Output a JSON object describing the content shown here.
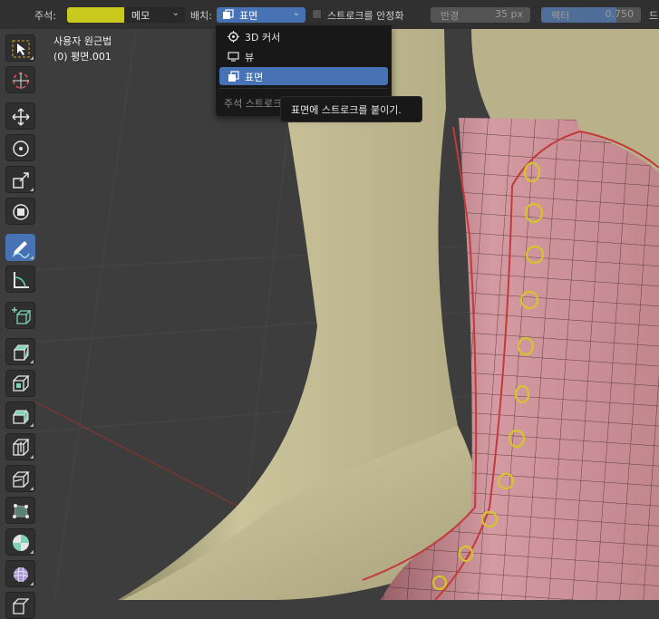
{
  "header": {
    "annotate_label": "주석:",
    "annotate_color": "#c8c81e",
    "layer_dropdown": "메모",
    "placement_label": "배치:",
    "placement_value": "표면",
    "stabilize_label": "스트로크를 안정화",
    "radius_label": "반경",
    "radius_value": "35 px",
    "factor_label": "팩터",
    "factor_value": "0.750",
    "factor_fill_fraction": 0.75,
    "overflow_label": "드"
  },
  "viewport_info": {
    "view_name": "사용자 원근법",
    "object_name": "(0) 평면.001"
  },
  "placement_menu": {
    "items": [
      {
        "label": "3D 커서",
        "icon": "cursor-icon",
        "selected": false
      },
      {
        "label": "뷰",
        "icon": "view-icon",
        "selected": false
      },
      {
        "label": "표면",
        "icon": "surface-icon",
        "selected": true
      }
    ],
    "description": "주석 스트로크를"
  },
  "tooltip": {
    "text": "표면에 스트로크를 붙이기."
  },
  "toolbar": {
    "active_tool": "annotate"
  },
  "colors": {
    "accent": "#4772b3",
    "mesh_pink": "#c98c93",
    "skin": "#c9c197",
    "annotation": "#d6c52a",
    "outline_red": "#c23a3a"
  }
}
